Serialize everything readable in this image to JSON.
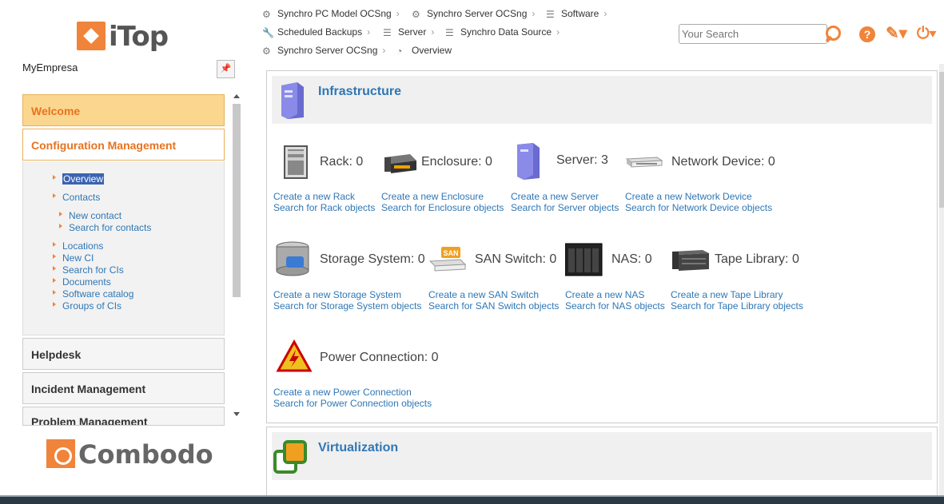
{
  "brand": {
    "logo_text": "iTop",
    "organization": "MyEmpresa",
    "footer_logo_text": "Combodo"
  },
  "menu": {
    "groups": {
      "welcome": "Welcome",
      "config": "Configuration Management",
      "helpdesk": "Helpdesk",
      "incident": "Incident Management",
      "problem": "Problem Management"
    },
    "config_items": {
      "overview": "Overview",
      "contacts": "Contacts",
      "new_contact": "New contact",
      "search_contacts": "Search for contacts",
      "locations": "Locations",
      "new_ci": "New CI",
      "search_cis": "Search for CIs",
      "documents": "Documents",
      "software_catalog": "Software catalog",
      "groups_cis": "Groups of CIs"
    }
  },
  "breadcrumbs": [
    {
      "label": "Synchro PC Model OCSng",
      "icon": "synchro-icon"
    },
    {
      "label": "Synchro Server OCSng",
      "icon": "synchro-icon"
    },
    {
      "label": "Software",
      "icon": "list-icon"
    },
    {
      "label": "Scheduled Backups",
      "icon": "wrench-icon"
    },
    {
      "label": "Server",
      "icon": "list-icon"
    },
    {
      "label": "Synchro Data Source",
      "icon": "list-icon"
    },
    {
      "label": "Synchro Server OCSng",
      "icon": "synchro-icon"
    },
    {
      "label": "Overview",
      "icon": "pie-icon"
    }
  ],
  "search": {
    "placeholder": "Your Search"
  },
  "infrastructure": {
    "title": "Infrastructure",
    "items": [
      {
        "label": "Rack: 0",
        "create": "Create a new Rack",
        "search": "Search for Rack objects"
      },
      {
        "label": "Enclosure: 0",
        "create": "Create a new Enclosure",
        "search": "Search for Enclosure objects"
      },
      {
        "label": "Server: 3",
        "create": "Create a new Server",
        "search": "Search for Server objects"
      },
      {
        "label": "Network Device: 0",
        "create": "Create a new Network Device",
        "search": "Search for Network Device objects"
      },
      {
        "label": "Storage System: 0",
        "create": "Create a new Storage System",
        "search": "Search for Storage System objects"
      },
      {
        "label": "SAN Switch: 0",
        "create": "Create a new SAN Switch",
        "search": "Search for SAN Switch objects"
      },
      {
        "label": "NAS: 0",
        "create": "Create a new NAS",
        "search": "Search for NAS objects"
      },
      {
        "label": "Tape Library: 0",
        "create": "Create a new Tape Library",
        "search": "Search for Tape Library objects"
      },
      {
        "label": "Power Connection: 0",
        "create": "Create a new Power Connection",
        "search": "Search for Power Connection objects"
      }
    ]
  },
  "virtualization": {
    "title": "Virtualization"
  },
  "icons": {
    "san_badge": "SAN"
  },
  "colors": {
    "accent": "#f0843a",
    "link": "#2f77b5",
    "welcome_bg": "#fbd68f"
  }
}
